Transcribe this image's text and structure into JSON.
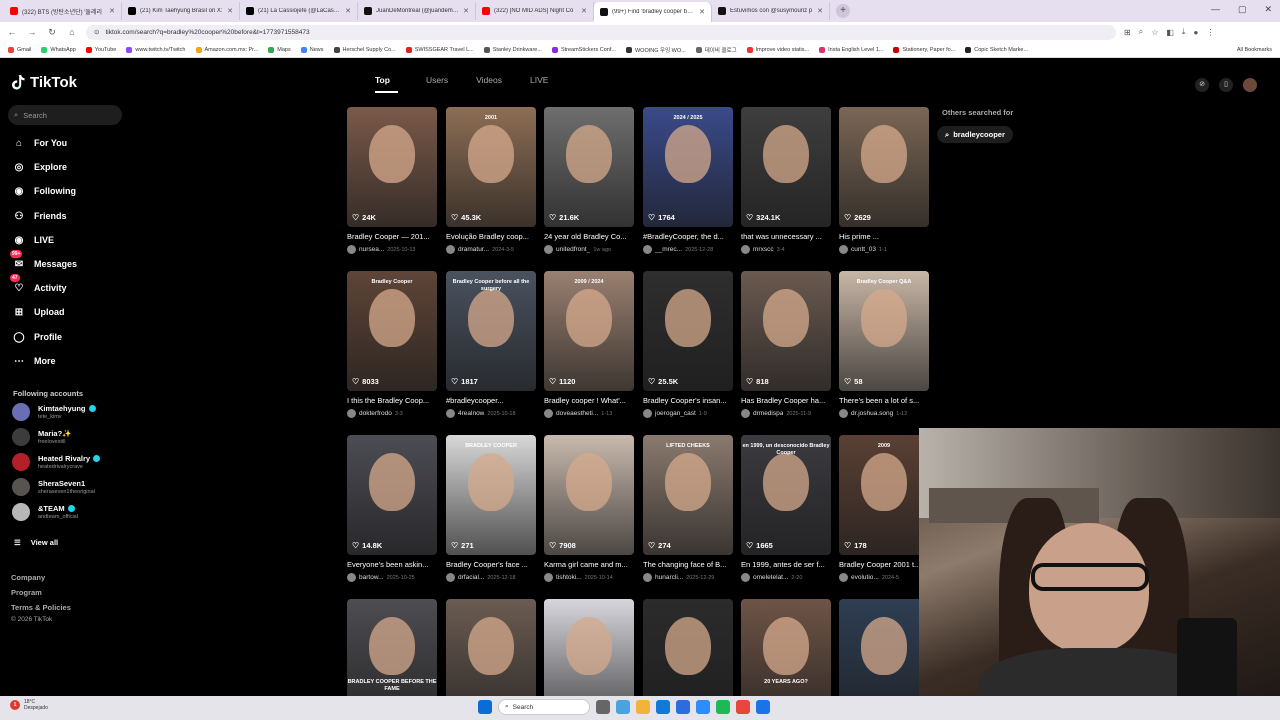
{
  "browser": {
    "tabs": [
      {
        "label": "(322) BTS (방탄소년단) '둘레리",
        "color": "#ff0000",
        "active": false
      },
      {
        "label": "(21) Kim Taehyung Brasil on X:",
        "color": "#000000",
        "active": false
      },
      {
        "label": "(21) La Cassiojefe (@LaCassioje",
        "color": "#000000",
        "active": false
      },
      {
        "label": "JuanDeMontreal (@juandemon",
        "color": "#111111",
        "active": false
      },
      {
        "label": "(322) [NO MID ADS] Night Co",
        "color": "#ff0000",
        "active": false
      },
      {
        "label": "(99+) Find 'bradley cooper befo",
        "color": "#111111",
        "active": true
      },
      {
        "label": "Estuvimos con @susymouriz p",
        "color": "#111111",
        "active": false
      }
    ],
    "url": "tiktok.com/search?q=bradley%20cooper%20before&t=1773971558473",
    "bookmarks": [
      {
        "label": "Gmail",
        "color": "#ea4335"
      },
      {
        "label": "WhatsApp",
        "color": "#25d366"
      },
      {
        "label": "YouTube",
        "color": "#ff0000"
      },
      {
        "label": "www.twitch.tv/Twitch",
        "color": "#9146ff"
      },
      {
        "label": "Amazon.com.mx: Pr...",
        "color": "#f7a21b"
      },
      {
        "label": "Maps",
        "color": "#34a853"
      },
      {
        "label": "News",
        "color": "#4285f4"
      },
      {
        "label": "Herschel Supply Co...",
        "color": "#444444"
      },
      {
        "label": "SWISSGEAR Travel L...",
        "color": "#d22"
      },
      {
        "label": "Stanley Drinkware...",
        "color": "#555555"
      },
      {
        "label": "StreamStickers Conf...",
        "color": "#8a2be2"
      },
      {
        "label": "WOOING 우잉 WO...",
        "color": "#333333"
      },
      {
        "label": "데이비 클로그",
        "color": "#666666"
      },
      {
        "label": "Improve video statis...",
        "color": "#e33"
      },
      {
        "label": "Insta English Level 1...",
        "color": "#e1306c"
      },
      {
        "label": "Stationery, Paper fo...",
        "color": "#c00"
      },
      {
        "label": "Copic Sketch Marke...",
        "color": "#222222"
      }
    ],
    "all_bookmarks": "All Bookmarks"
  },
  "sidebar": {
    "logo": "TikTok",
    "search_placeholder": "Search",
    "nav": [
      {
        "label": "For You",
        "icon": "home-icon"
      },
      {
        "label": "Explore",
        "icon": "compass-icon"
      },
      {
        "label": "Following",
        "icon": "following-icon"
      },
      {
        "label": "Friends",
        "icon": "friends-icon"
      },
      {
        "label": "LIVE",
        "icon": "live-icon"
      },
      {
        "label": "Messages",
        "icon": "messages-icon",
        "badge": "99+"
      },
      {
        "label": "Activity",
        "icon": "activity-icon",
        "badge": "47"
      },
      {
        "label": "Upload",
        "icon": "upload-icon"
      },
      {
        "label": "Profile",
        "icon": "profile-icon"
      },
      {
        "label": "More",
        "icon": "more-icon"
      }
    ],
    "following_title": "Following accounts",
    "accounts": [
      {
        "name": "Kimtaehyung",
        "handle": "tete_kimv",
        "verified": true,
        "color": "#6a6fb3"
      },
      {
        "name": "Maria?✨",
        "handle": "freelovestill",
        "verified": false,
        "color": "#3c3c3c"
      },
      {
        "name": "Heated Rivalry",
        "handle": "heatedrivalrycrave",
        "verified": true,
        "color": "#b3202a"
      },
      {
        "name": "SheraSeven1",
        "handle": "sheraseven1theoriginal",
        "verified": false,
        "color": "#57534e"
      },
      {
        "name": "&TEAM",
        "handle": "andteam_official",
        "verified": true,
        "color": "#b8b8b8"
      }
    ],
    "view_all": "View all",
    "footer": [
      "Company",
      "Program",
      "Terms & Policies"
    ],
    "copyright": "© 2026 TikTok"
  },
  "search": {
    "tabs": [
      "Top",
      "Users",
      "Videos",
      "LIVE"
    ],
    "active_tab": "Top",
    "others_title": "Others searched for",
    "others_chip": "bradleycooper"
  },
  "results": [
    {
      "title": "Bradley Cooper — 201...",
      "user": "nursea...",
      "date": "2025-10-13",
      "views": "24K",
      "bg": "#7a5a4a",
      "overlay": ""
    },
    {
      "title": "Evolução Bradley coop...",
      "user": "dramatur...",
      "date": "2024-3-5",
      "views": "45.3K",
      "bg": "#8d6e55",
      "overlay": "2001"
    },
    {
      "title": "24 year old Bradley Co...",
      "user": "unitedfront_",
      "date": "1w ago",
      "views": "21.6K",
      "bg": "#6e6e6e",
      "overlay": ""
    },
    {
      "title": "#BradleyCooper, the d...",
      "user": "__mrec...",
      "date": "2025-12-28",
      "views": "1764",
      "bg": "#3a4a8a",
      "overlay": "2024 / 2025"
    },
    {
      "title": "that was unnecessary ...",
      "user": "mrxscc",
      "date": "3-4",
      "views": "324.1K",
      "bg": "#3e3e3e",
      "overlay": ""
    },
    {
      "title": "His prime ...",
      "user": "cuntt_03",
      "date": "1-1",
      "views": "2629",
      "bg": "#7a6655",
      "overlay": ""
    },
    {
      "title": "I this the Bradley Coop...",
      "user": "dokterfrodo",
      "date": "3-3",
      "views": "8033",
      "bg": "#5e4537",
      "overlay": "Bradley Cooper"
    },
    {
      "title": "#bradleycooper...",
      "user": "4realnow",
      "date": "2025-10-18",
      "views": "1817",
      "bg": "#4a5260",
      "overlay": "Bradley Cooper before all the surgery"
    },
    {
      "title": "Bradley cooper ! What'...",
      "user": "doveaestheti...",
      "date": "1-13",
      "views": "1120",
      "bg": "#9a8070",
      "overlay": "2009 / 2024"
    },
    {
      "title": "Bradley Cooper's insan...",
      "user": "joerogan_cast",
      "date": "1-9",
      "views": "25.5K",
      "bg": "#2e2e2e",
      "overlay": ""
    },
    {
      "title": "Has Bradley Cooper ha...",
      "user": "drmedispa",
      "date": "2025-11-9",
      "views": "818",
      "bg": "#6a5a50",
      "overlay": ""
    },
    {
      "title": "There's been a lot of s...",
      "user": "dr.joshua.song",
      "date": "1-12",
      "views": "58",
      "bg": "#c7b6a6",
      "overlay": "Bradley Cooper Q&A"
    },
    {
      "title": "Everyone's been askin...",
      "user": "bartow...",
      "date": "2025-10-25",
      "views": "14.8K",
      "bg": "#4c4c54",
      "overlay": ""
    },
    {
      "title": "Bradley Cooper's face ...",
      "user": "drfacial...",
      "date": "2025-12-18",
      "views": "271",
      "bg": "#d8d8d8",
      "overlay": "BRADLEY COOPER"
    },
    {
      "title": "Karma girl came and m...",
      "user": "tishtoki...",
      "date": "2025-10-14",
      "views": "7908",
      "bg": "#c9b9ad",
      "overlay": ""
    },
    {
      "title": "The changing face of B...",
      "user": "hunarcli...",
      "date": "2025-12-29",
      "views": "274",
      "bg": "#8a7a6e",
      "overlay": "LIFTED CHEEKS"
    },
    {
      "title": "En 1999, antes de ser f...",
      "user": "omeletelat...",
      "date": "2-20",
      "views": "1665",
      "bg": "#3b3b40",
      "overlay": "en 1999, un desconocido Bradley Cooper"
    },
    {
      "title": "Bradley Cooper 2001 t...",
      "user": "evolutio...",
      "date": "2024-5",
      "views": "178",
      "bg": "#5a4034",
      "overlay": "2009"
    },
    {
      "title": "",
      "user": "",
      "date": "",
      "views": "",
      "bg": "#4d4d52",
      "overlay": "BRADLEY COOPER BEFORE THE FAME"
    },
    {
      "title": "",
      "user": "",
      "date": "",
      "views": "",
      "bg": "#6b5c52",
      "overlay": ""
    },
    {
      "title": "",
      "user": "",
      "date": "",
      "views": "",
      "bg": "#d6d6dc",
      "overlay": ""
    },
    {
      "title": "",
      "user": "",
      "date": "",
      "views": "",
      "bg": "#2b2b2b",
      "overlay": ""
    },
    {
      "title": "",
      "user": "",
      "date": "",
      "views": "",
      "bg": "#6e5446",
      "overlay": "20 YEARS AGO?"
    },
    {
      "title": "",
      "user": "",
      "date": "",
      "views": "",
      "bg": "#2f3e54",
      "overlay": ""
    }
  ],
  "taskbar": {
    "weather_temp": "18°C",
    "weather_desc": "Despejado",
    "search_label": "Search"
  }
}
